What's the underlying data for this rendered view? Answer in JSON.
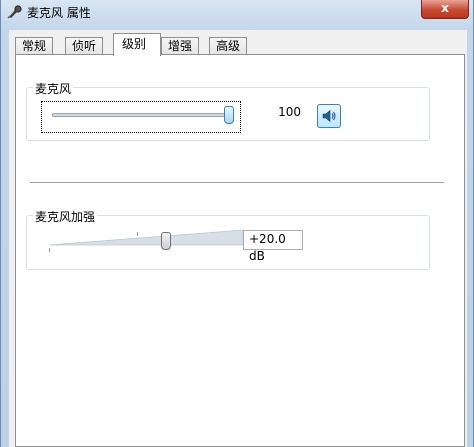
{
  "window": {
    "title": "麦克风 属性",
    "close_label": "x"
  },
  "tabs": [
    {
      "label": "常规",
      "active": false
    },
    {
      "label": "侦听",
      "active": false
    },
    {
      "label": "级别",
      "active": true
    },
    {
      "label": "增强",
      "active": false
    },
    {
      "label": "高级",
      "active": false
    }
  ],
  "microphone": {
    "label": "麦克风",
    "level": 100,
    "level_text": "100",
    "mute_icon": "speaker-icon"
  },
  "boost": {
    "label": "麦克风加强",
    "value_text": "+20.0 dB",
    "level_fraction": 0.67
  }
}
